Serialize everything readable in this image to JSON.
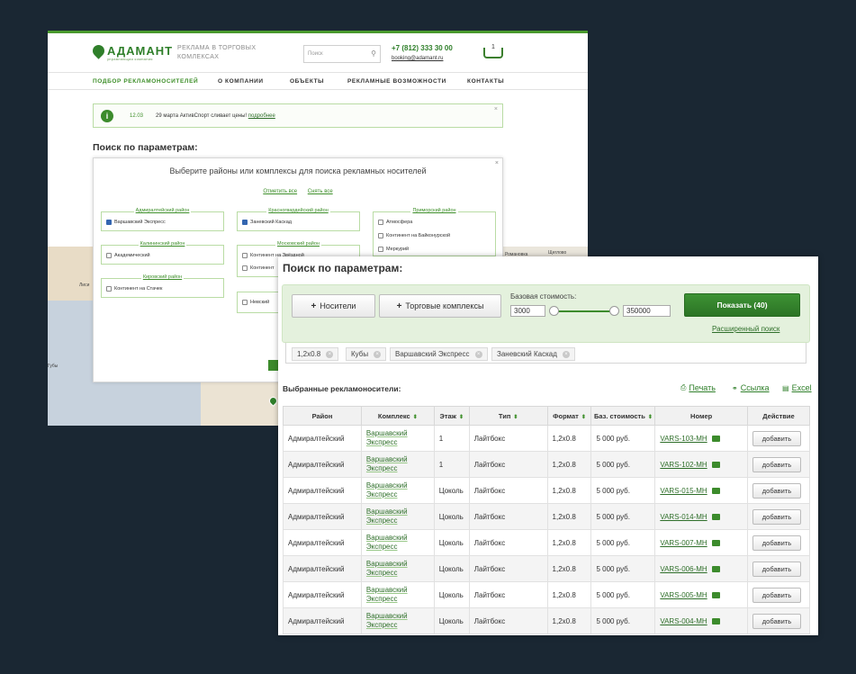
{
  "colors": {
    "background": "#1a2733",
    "brand_green": "#3c8b2c",
    "panel_green": "#e4f1dd",
    "link_green": "#2f6f2a"
  },
  "back": {
    "logo": {
      "name": "АДАМАНТ",
      "sub": "управляющая компания"
    },
    "tagline": "РЕКЛАМА В ТОРГОВЫХ КОМЛЕКСАХ",
    "search_placeholder": "Поиск",
    "phone": "+7 (812) 333 30 00",
    "email": "booking@adamant.ru",
    "cart_count": "1",
    "nav": [
      "ПОДБОР РЕКЛАМОНОСИТЕЛЕЙ",
      "О КОМПАНИИ",
      "ОБЪЕКТЫ",
      "РЕКЛАМНЫЕ ВОЗМОЖНОСТИ",
      "КОНТАКТЫ"
    ],
    "notice": {
      "date": "12.03",
      "text": "29 марта АктивСпорт сливает цены!",
      "link": "подробнее"
    },
    "title": "Поиск по параметрам:",
    "modal": {
      "title": "Выберите районы или комплексы для поиска рекламных носителей",
      "select_all": "Отметить все",
      "deselect_all": "Снять все",
      "districts": [
        {
          "name": "Адмиралтейский район",
          "options": [
            {
              "label": "Варшавский Экспресс",
              "checked": true
            }
          ]
        },
        {
          "name": "Красногвардейский район",
          "options": [
            {
              "label": "Заневский Каскад",
              "checked": true
            }
          ]
        },
        {
          "name": "Приморский район",
          "options": [
            {
              "label": "Атмосфера",
              "checked": false
            },
            {
              "label": "Континент на Байконурской",
              "checked": false
            },
            {
              "label": "Меркурий",
              "checked": false
            }
          ]
        },
        {
          "name": "Калининский район",
          "options": [
            {
              "label": "Академический",
              "checked": false
            }
          ]
        },
        {
          "name": "Московский район",
          "options": [
            {
              "label": "Континент на Звёздной",
              "checked": false
            },
            {
              "label": "Континент",
              "checked": false
            }
          ]
        },
        {
          "name": "Кировский район",
          "options": [
            {
              "label": "Континент на Стачек",
              "checked": false
            }
          ]
        },
        {
          "name": "",
          "options": [
            {
              "label": "Невский",
              "checked": false
            }
          ]
        }
      ]
    },
    "map_labels": [
      "Лиси",
      "Щеглово",
      "Романовка",
      "Губы"
    ]
  },
  "front": {
    "title": "Поиск по параметрам:",
    "buttons": {
      "carriers": "Носители",
      "complexes": "Торговые комплексы",
      "show": "Показать  (40)"
    },
    "price": {
      "label": "Базовая стоимость:",
      "min": "3000",
      "max": "350000"
    },
    "advanced_link": "Расширенный поиск",
    "tags": [
      "1,2x0.8",
      "Кубы",
      "Варшавский Экспресс",
      "Заневский Каскад"
    ],
    "selected_title": "Выбранные рекламоносители:",
    "actions": {
      "print": "Печать",
      "link": "Ссылка",
      "excel": "Excel"
    },
    "table": {
      "headers": [
        "Район",
        "Комплекс",
        "Этаж",
        "Тип",
        "Формат",
        "Баз. стоимость",
        "Номер",
        "Действие"
      ],
      "add_label": "добавить",
      "rows": [
        {
          "district": "Адмиралтейский",
          "complex_1": "Варшавский",
          "complex_2": "Экспресс",
          "floor": "1",
          "type": "Лайтбокс",
          "format": "1,2x0.8",
          "price": "5 000 руб.",
          "number": "VARS-103-MH"
        },
        {
          "district": "Адмиралтейский",
          "complex_1": "Варшавский",
          "complex_2": "Экспресс",
          "floor": "1",
          "type": "Лайтбокс",
          "format": "1,2x0.8",
          "price": "5 000 руб.",
          "number": "VARS-102-MH"
        },
        {
          "district": "Адмиралтейский",
          "complex_1": "Варшавский",
          "complex_2": "Экспресс",
          "floor": "Цоколь",
          "type": "Лайтбокс",
          "format": "1,2x0.8",
          "price": "5 000 руб.",
          "number": "VARS-015-MH"
        },
        {
          "district": "Адмиралтейский",
          "complex_1": "Варшавский",
          "complex_2": "Экспресс",
          "floor": "Цоколь",
          "type": "Лайтбокс",
          "format": "1,2x0.8",
          "price": "5 000 руб.",
          "number": "VARS-014-MH"
        },
        {
          "district": "Адмиралтейский",
          "complex_1": "Варшавский",
          "complex_2": "Экспресс",
          "floor": "Цоколь",
          "type": "Лайтбокс",
          "format": "1,2x0.8",
          "price": "5 000 руб.",
          "number": "VARS-007-MH"
        },
        {
          "district": "Адмиралтейский",
          "complex_1": "Варшавский",
          "complex_2": "Экспресс",
          "floor": "Цоколь",
          "type": "Лайтбокс",
          "format": "1,2x0.8",
          "price": "5 000 руб.",
          "number": "VARS-006-MH"
        },
        {
          "district": "Адмиралтейский",
          "complex_1": "Варшавский",
          "complex_2": "Экспресс",
          "floor": "Цоколь",
          "type": "Лайтбокс",
          "format": "1,2x0.8",
          "price": "5 000 руб.",
          "number": "VARS-005-MH"
        },
        {
          "district": "Адмиралтейский",
          "complex_1": "Варшавский",
          "complex_2": "Экспресс",
          "floor": "Цоколь",
          "type": "Лайтбокс",
          "format": "1,2x0.8",
          "price": "5 000 руб.",
          "number": "VARS-004-MH"
        }
      ]
    }
  }
}
